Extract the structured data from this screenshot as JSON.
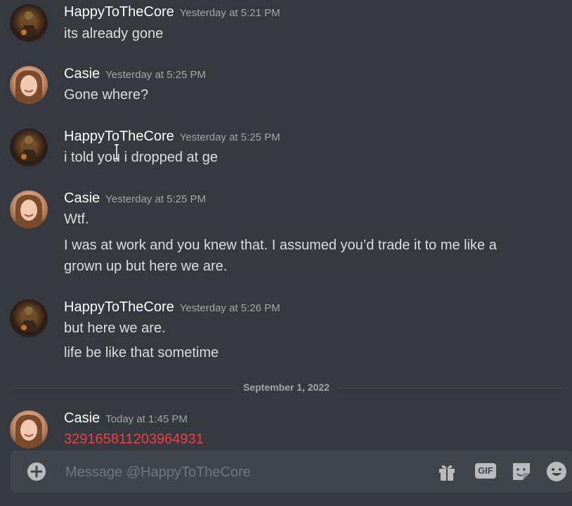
{
  "messages": [
    {
      "author": "HappyToTheCore",
      "time": "Yesterday at 5:21 PM",
      "lines": [
        "its already gone"
      ]
    },
    {
      "author": "Casie",
      "time": "Yesterday at 5:25 PM",
      "lines": [
        "Gone where?"
      ]
    },
    {
      "author": "HappyToTheCore",
      "time": "Yesterday at 5:25 PM",
      "lines": [
        "i told you i dropped at ge"
      ]
    },
    {
      "author": "Casie",
      "time": "Yesterday at 5:25 PM",
      "lines": [
        "Wtf.",
        "I was at work and you knew that. I assumed you’d trade it to me like a",
        "grown up but here we are."
      ]
    },
    {
      "author": "HappyToTheCore",
      "time": "Yesterday at 5:26 PM",
      "lines": [
        "but here we are.",
        "life be like that sometime"
      ]
    },
    {
      "author": "Casie",
      "time": "Today at 1:45 PM",
      "lines": [
        "329165811203964931"
      ]
    }
  ],
  "divider": {
    "label": "September 1, 2022"
  },
  "composer": {
    "placeholder": "Message @HappyToTheCore",
    "gif_label": "GIF",
    "icons": [
      "add-icon",
      "gift-icon",
      "gif-icon",
      "sticker-icon",
      "emoji-icon"
    ]
  },
  "colors": {
    "background": "#36393f",
    "composer": "#40444b",
    "username": "#ffffff",
    "timestamp": "#a3a6aa",
    "text": "#dcddde",
    "highlight_red": "#ed4245"
  }
}
